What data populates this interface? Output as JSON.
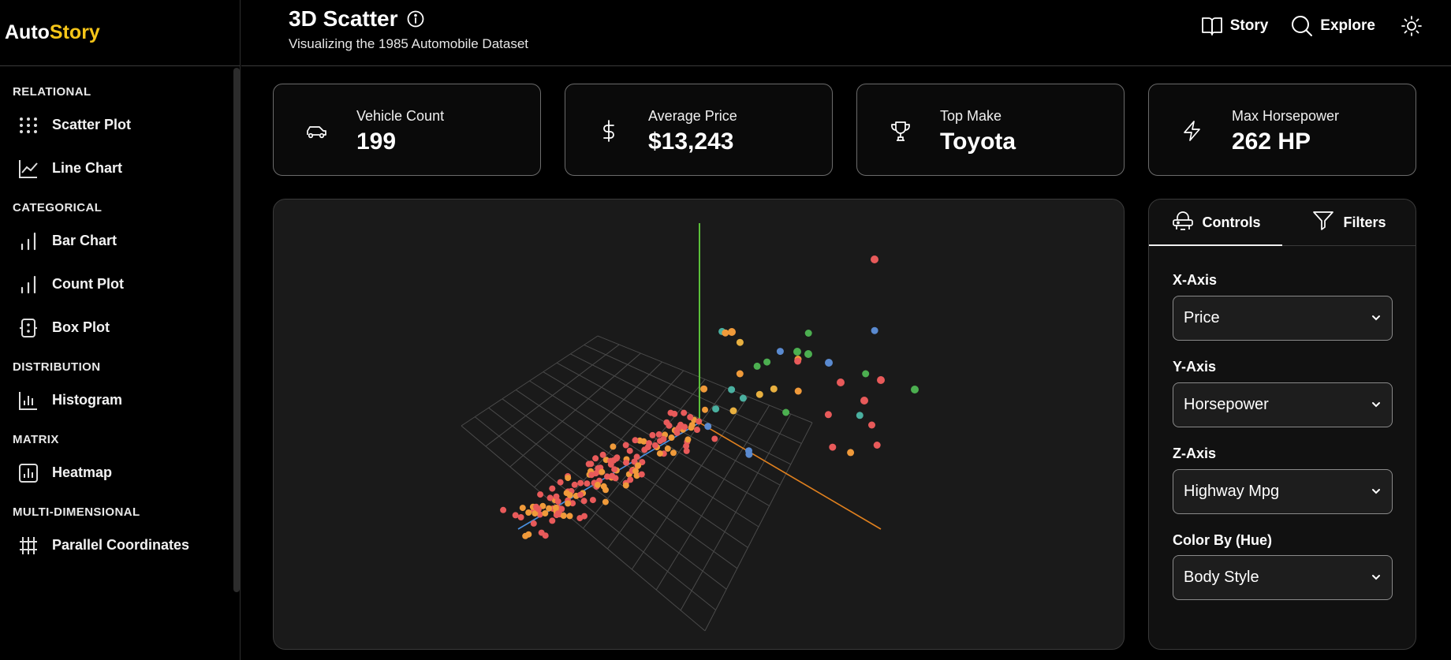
{
  "brand": {
    "part1": "Auto",
    "part2": "Story",
    "accent_color": "#f5c518"
  },
  "sidebar": {
    "sections": [
      {
        "title": "RELATIONAL",
        "items": [
          {
            "label": "Scatter Plot",
            "icon": "scatter-icon"
          },
          {
            "label": "Line Chart",
            "icon": "line-chart-icon"
          }
        ]
      },
      {
        "title": "CATEGORICAL",
        "items": [
          {
            "label": "Bar Chart",
            "icon": "bar-chart-icon"
          },
          {
            "label": "Count Plot",
            "icon": "count-plot-icon"
          },
          {
            "label": "Box Plot",
            "icon": "box-plot-icon"
          }
        ]
      },
      {
        "title": "DISTRIBUTION",
        "items": [
          {
            "label": "Histogram",
            "icon": "histogram-icon"
          }
        ]
      },
      {
        "title": "MATRIX",
        "items": [
          {
            "label": "Heatmap",
            "icon": "heatmap-icon"
          }
        ]
      },
      {
        "title": "MULTI-DIMENSIONAL",
        "items": [
          {
            "label": "Parallel Coordinates",
            "icon": "parallel-coordinates-icon"
          }
        ]
      }
    ]
  },
  "header": {
    "title": "3D Scatter",
    "subtitle": "Visualizing the 1985 Automobile Dataset",
    "nav": [
      {
        "label": "Story",
        "icon": "book-icon"
      },
      {
        "label": "Explore",
        "icon": "search-icon"
      }
    ],
    "theme_icon": "sun-icon"
  },
  "stats": [
    {
      "label": "Vehicle Count",
      "value": "199",
      "icon": "car-icon"
    },
    {
      "label": "Average Price",
      "value": "$13,243",
      "icon": "dollar-icon"
    },
    {
      "label": "Top Make",
      "value": "Toyota",
      "icon": "trophy-icon"
    },
    {
      "label": "Max Horsepower",
      "value": "262 HP",
      "icon": "zap-icon"
    }
  ],
  "panel": {
    "tabs": [
      {
        "label": "Controls",
        "icon": "controls-icon",
        "active": true
      },
      {
        "label": "Filters",
        "icon": "filter-icon",
        "active": false
      }
    ],
    "fields": [
      {
        "label": "X-Axis",
        "value": "Price"
      },
      {
        "label": "Y-Axis",
        "value": "Horsepower"
      },
      {
        "label": "Z-Axis",
        "value": "Highway Mpg"
      },
      {
        "label": "Color By (Hue)",
        "value": "Body Style"
      }
    ]
  },
  "colors": {
    "axis_x": "#4a90e2",
    "axis_y": "#5bbf3a",
    "axis_z": "#e0801e",
    "points": [
      "#e85a5a",
      "#f09a3a",
      "#5a8ad0",
      "#4caf50",
      "#4ab0a0",
      "#e8b040"
    ]
  }
}
